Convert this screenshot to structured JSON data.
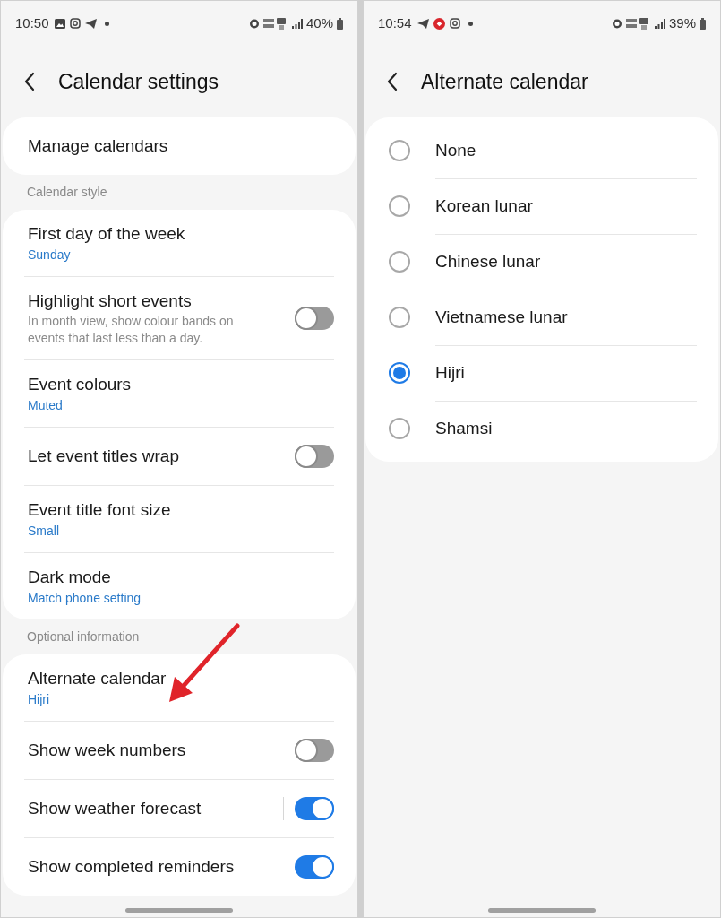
{
  "screens": [
    {
      "status_bar": {
        "time": "10:50",
        "battery": "40%"
      },
      "title": "Calendar settings",
      "sections": [
        {
          "items": [
            {
              "kind": "link",
              "label": "Manage calendars"
            }
          ]
        },
        {
          "header": "Calendar style",
          "items": [
            {
              "kind": "link",
              "label": "First day of the week",
              "value": "Sunday"
            },
            {
              "kind": "toggle",
              "label": "Highlight short events",
              "description": "In month view, show colour bands on events that last less than a day.",
              "on": false
            },
            {
              "kind": "link",
              "label": "Event colours",
              "value": "Muted"
            },
            {
              "kind": "toggle",
              "label": "Let event titles wrap",
              "on": false
            },
            {
              "kind": "link",
              "label": "Event title font size",
              "value": "Small"
            },
            {
              "kind": "link",
              "label": "Dark mode",
              "value": "Match phone setting"
            }
          ]
        },
        {
          "header": "Optional information",
          "items": [
            {
              "kind": "link",
              "label": "Alternate calendar",
              "value": "Hijri"
            },
            {
              "kind": "toggle",
              "label": "Show week numbers",
              "on": false
            },
            {
              "kind": "toggle",
              "label": "Show weather forecast",
              "on": true,
              "split": true
            },
            {
              "kind": "toggle",
              "label": "Show completed reminders",
              "on": true
            }
          ]
        }
      ]
    },
    {
      "status_bar": {
        "time": "10:54",
        "battery": "39%"
      },
      "title": "Alternate calendar",
      "options": [
        {
          "label": "None",
          "selected": false
        },
        {
          "label": "Korean lunar",
          "selected": false
        },
        {
          "label": "Chinese lunar",
          "selected": false
        },
        {
          "label": "Vietnamese lunar",
          "selected": false
        },
        {
          "label": "Hijri",
          "selected": true
        },
        {
          "label": "Shamsi",
          "selected": false
        }
      ]
    }
  ]
}
